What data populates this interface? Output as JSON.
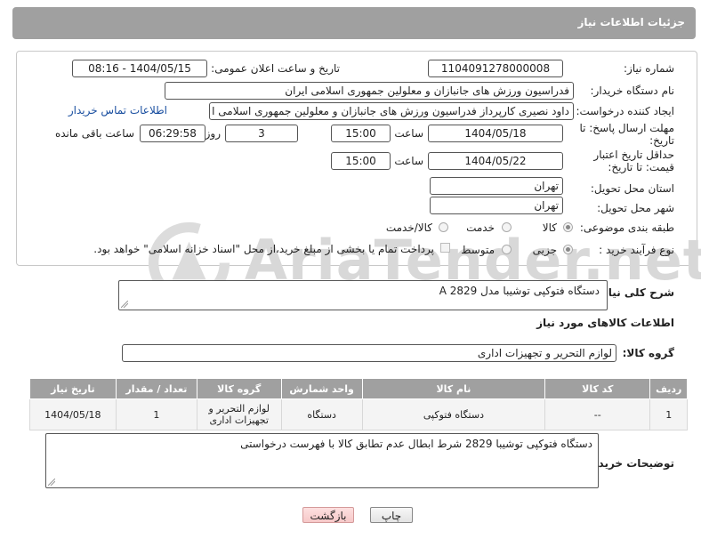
{
  "header": {
    "title": "جزئیات اطلاعات نیاز"
  },
  "form": {
    "need_number": {
      "label": "شماره نیاز:",
      "value": "1104091278000008"
    },
    "announce_datetime": {
      "label": "تاریخ و ساعت اعلان عمومی:",
      "value": "1404/05/15 - 08:16"
    },
    "buyer_org": {
      "label": "نام دستگاه خریدار:",
      "value": "فدراسیون ورزش های جانبازان و معلولین جمهوری اسلامی ایران"
    },
    "requester": {
      "label": "ایجاد کننده درخواست:",
      "value": "داود نصیری کارپرداز فدراسیون ورزش های جانبازان و معلولین جمهوری اسلامی ا",
      "contact_link": "اطلاعات تماس خریدار"
    },
    "reply_deadline": {
      "label": "مهلت ارسال پاسخ: تا تاریخ:",
      "date": "1404/05/18",
      "time_label": "ساعت",
      "time": "15:00",
      "days": "3",
      "days_label": "روز و",
      "remaining": "06:29:58",
      "remaining_label": "ساعت باقی مانده"
    },
    "price_validity": {
      "label": "حداقل تاریخ اعتبار قیمت: تا تاریخ:",
      "date": "1404/05/22",
      "time_label": "ساعت",
      "time": "15:00"
    },
    "delivery_province": {
      "label": "استان محل تحویل:",
      "value": "تهران"
    },
    "delivery_city": {
      "label": "شهر محل تحویل:",
      "value": "تهران"
    },
    "category": {
      "label": "طبقه بندی موضوعی:",
      "options": [
        "کالا",
        "خدمت",
        "کالا/خدمت"
      ],
      "selected": "کالا"
    },
    "process_type": {
      "label": "نوع فرآیند خرید :",
      "options": [
        "جزیی",
        "متوسط"
      ],
      "selected": "جزیی",
      "payment_note": "پرداخت تمام یا بخشی از مبلغ خرید،از محل \"اسناد خزانه اسلامی\" خواهد بود."
    }
  },
  "watermark": {
    "text": "AriaTender.net"
  },
  "general_description": {
    "label": "شرح کلی نیاز:",
    "value": "دستگاه فتوکپی توشیبا مدل 2829 A"
  },
  "goods_info": {
    "title": "اطلاعات کالاهای مورد نیاز",
    "group_label": "گروه کالا:",
    "group_value": "لوازم التحریر و تجهیزات اداری"
  },
  "table": {
    "headers": [
      "ردیف",
      "کد کالا",
      "نام کالا",
      "واحد شمارش",
      "گروه کالا",
      "تعداد / مقدار",
      "تاریخ نیاز"
    ],
    "rows": [
      [
        "1",
        "--",
        "دستگاه فتوکپی",
        "دستگاه",
        "لوازم التحریر و تجهیزات اداری",
        "1",
        "1404/05/18"
      ]
    ]
  },
  "buyer_notes": {
    "label": "توضیحات خریدار:",
    "value": "دستگاه فتوکپی توشیبا 2829 شرط ابطال عدم تطابق کالا با فهرست درخواستی"
  },
  "buttons": {
    "print": "چاپ",
    "back": "بازگشت"
  }
}
